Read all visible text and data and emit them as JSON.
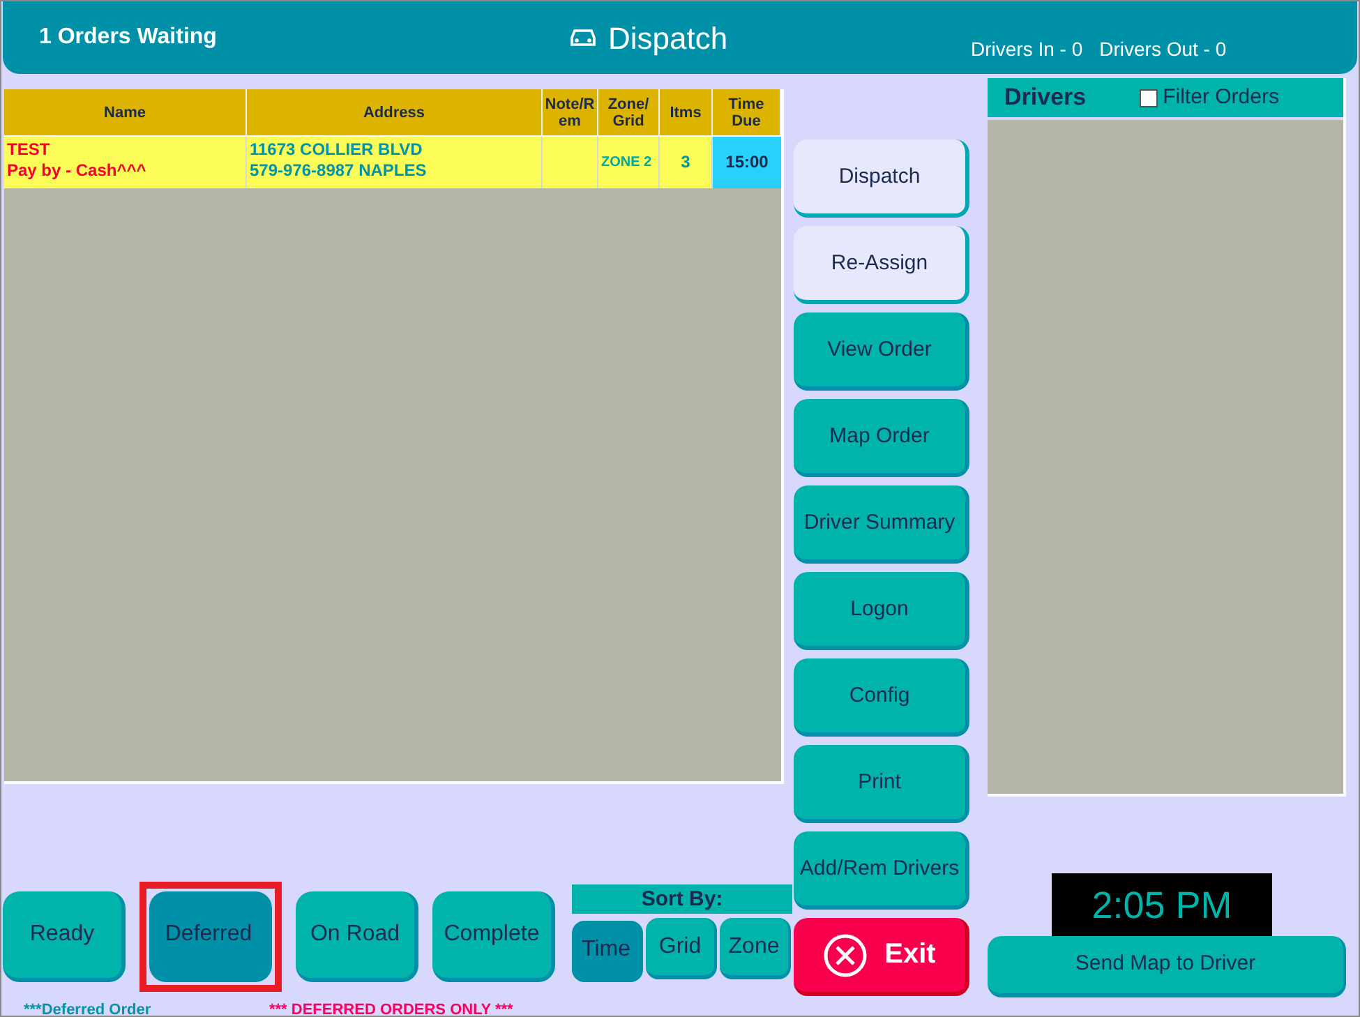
{
  "header": {
    "orders_waiting": "1 Orders Waiting",
    "title": "Dispatch",
    "drivers_in": "Drivers In - 0",
    "drivers_out": "Drivers Out - 0"
  },
  "table": {
    "columns": [
      "Name",
      "Address",
      "Note/R em",
      "Zone/ Grid",
      "Itms",
      "Time Due"
    ],
    "rows": [
      {
        "name": [
          "TEST",
          "Pay by - Cash^^^"
        ],
        "address": [
          "11673 COLLIER BLVD",
          "579-976-8987 NAPLES"
        ],
        "note": "",
        "zone": "ZONE 2",
        "items": "3",
        "time_due": "15:00"
      }
    ]
  },
  "legend": {
    "deferred_marker": "***Deferred Order",
    "filter_notice": "*** DEFERRED ORDERS ONLY ***"
  },
  "actions": [
    {
      "label": "Dispatch",
      "kind": "light"
    },
    {
      "label": "Re-Assign",
      "kind": "light"
    },
    {
      "label": "View Order",
      "kind": "normal"
    },
    {
      "label": "Map Order",
      "kind": "normal"
    },
    {
      "label": "Driver Summary",
      "kind": "normal"
    },
    {
      "label": "Logon",
      "kind": "normal"
    },
    {
      "label": "Config",
      "kind": "normal"
    },
    {
      "label": "Print",
      "kind": "normal"
    },
    {
      "label": "Add/Rem Drivers",
      "kind": "normal"
    },
    {
      "label": "Exit",
      "kind": "exit"
    }
  ],
  "drivers": {
    "title": "Drivers",
    "filter_label": "Filter Orders",
    "filter_checked": false
  },
  "status_tabs": [
    {
      "label": "Ready",
      "selected": false,
      "highlighted": false
    },
    {
      "label": "Deferred",
      "selected": true,
      "highlighted": true
    },
    {
      "label": "On Road",
      "selected": false,
      "highlighted": false
    },
    {
      "label": "Complete",
      "selected": false,
      "highlighted": false
    }
  ],
  "sort": {
    "title": "Sort By:",
    "options": [
      {
        "label": "Time",
        "selected": true
      },
      {
        "label": "Grid",
        "selected": false
      },
      {
        "label": "Zone",
        "selected": false
      }
    ]
  },
  "clock": "2:05 PM",
  "send_map_button": "Send Map to Driver"
}
